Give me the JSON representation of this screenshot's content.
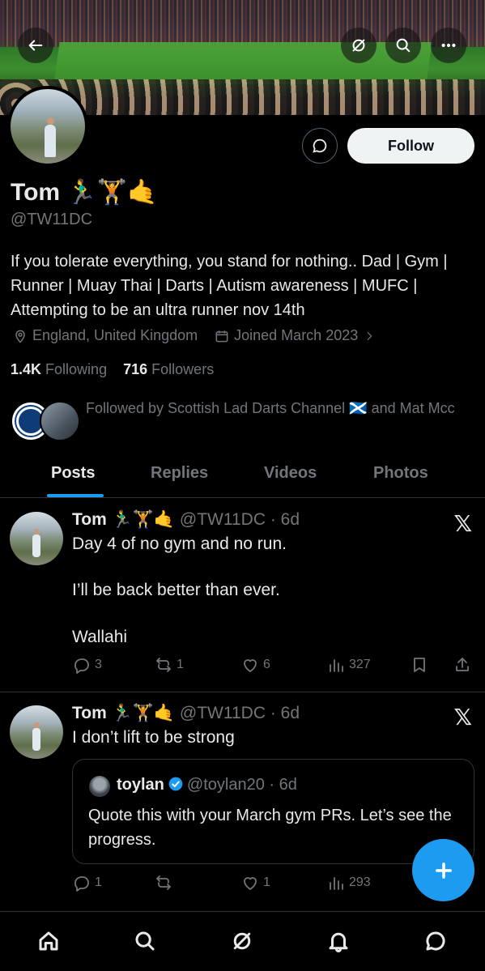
{
  "profile": {
    "name": "Tom 🏃‍♂️🏋️🤙",
    "handle": "@TW11DC",
    "bio": "If you tolerate everything, you stand for nothing.. Dad | Gym | Runner | Muay Thai | Darts | Autism awareness | MUFC | Attempting to be an ultra runner nov 14th",
    "location": "England, United Kingdom",
    "joined": "Joined March 2023",
    "following_count": "1.4K",
    "following_label": "Following",
    "followers_count": "716",
    "followers_label": "Followers",
    "followed_by": "Followed by Scottish Lad Darts Channel 🏴󠁧󠁢󠁳󠁣󠁴󠁿 and Mat Mcc",
    "follow_label": "Follow"
  },
  "tabs": [
    "Posts",
    "Replies",
    "Videos",
    "Photos"
  ],
  "active_tab": "Posts",
  "posts": [
    {
      "author": "Tom 🏃‍♂️🏋️🤙",
      "handle": "@TW11DC",
      "time": "· 6d",
      "lines": [
        "Day 4 of no gym and no run.",
        "I’ll be back better than ever.",
        "Wallahi"
      ],
      "replies": "3",
      "reposts": "1",
      "likes": "6",
      "views": "327"
    },
    {
      "author": "Tom 🏃‍♂️🏋️🤙",
      "handle": "@TW11DC",
      "time": "· 6d",
      "text": "I don’t lift to be strong",
      "quote": {
        "author": "toylan",
        "handle": "@toylan20",
        "time": "· 6d",
        "text": "Quote this with your March gym PRs. Let’s see the progress."
      },
      "replies": "1",
      "reposts": "",
      "likes": "1",
      "views": "293"
    }
  ],
  "colors": {
    "accent": "#1d9bf0",
    "muted": "#71767b",
    "text": "#e7e9ea",
    "background": "#000000",
    "border": "#2f3336"
  },
  "icons": [
    "back-arrow-icon",
    "grok-icon",
    "search-icon",
    "more-icon",
    "message-icon",
    "location-icon",
    "calendar-icon",
    "chevron-right-icon",
    "x-logo-icon",
    "reply-icon",
    "repost-icon",
    "like-icon",
    "views-icon",
    "bookmark-icon",
    "share-icon",
    "plus-icon",
    "home-icon",
    "notifications-icon",
    "messages-icon"
  ]
}
